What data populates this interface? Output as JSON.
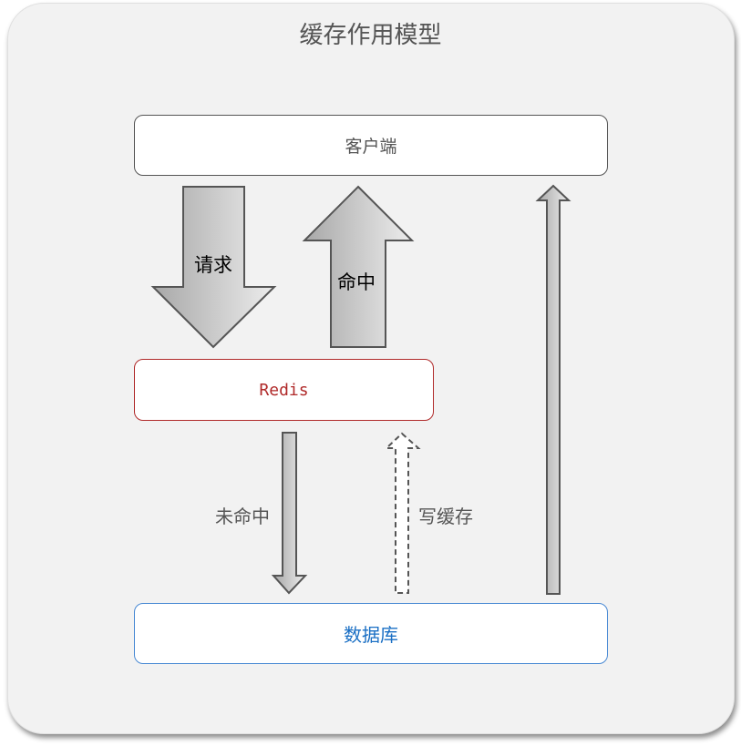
{
  "title": "缓存作用模型",
  "nodes": {
    "client": "客户端",
    "redis": "Redis",
    "database": "数据库"
  },
  "arrows": {
    "request": "请求",
    "hit": "命中",
    "miss": "未命中",
    "write_cache": "写缓存"
  },
  "colors": {
    "redis": "#b02a2a",
    "database": "#1a6fc4",
    "panel": "#f2f2f2"
  }
}
